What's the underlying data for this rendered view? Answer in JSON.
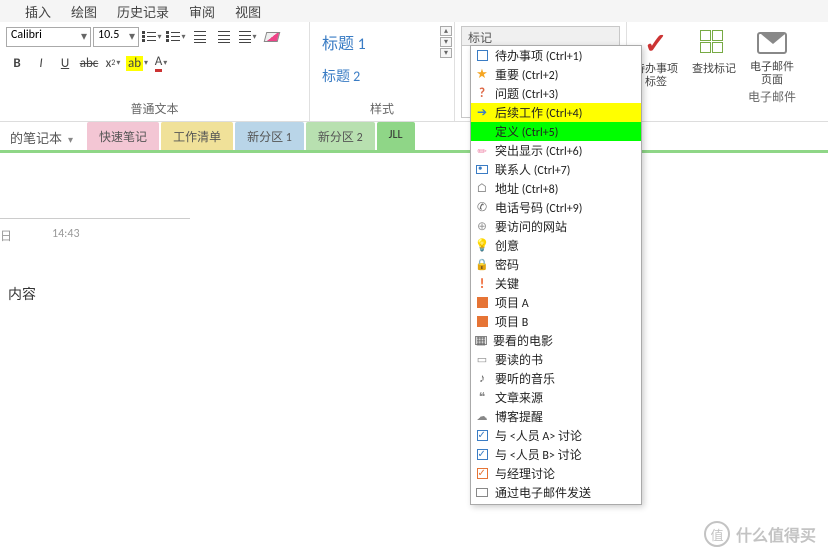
{
  "menu": [
    "插入",
    "绘图",
    "历史记录",
    "审阅",
    "视图"
  ],
  "font": {
    "name": "Calibri",
    "size": "10.5"
  },
  "styles": {
    "h1": "标题 1",
    "h2": "标题 2"
  },
  "groups": {
    "basic_text": "普通文本",
    "styles": "样式",
    "email": "电子邮件"
  },
  "tags_header": "标记",
  "big_buttons": {
    "todo": {
      "l1": "待办事项",
      "l2": "标签"
    },
    "find": "查找标记",
    "email": {
      "l1": "电子邮件",
      "l2": "页面"
    }
  },
  "notebook_name": "的笔记本",
  "sections": [
    {
      "label": "快速笔记",
      "cls": "tab-pink"
    },
    {
      "label": "工作清单",
      "cls": "tab-yellow"
    },
    {
      "label": "新分区 1",
      "cls": "tab-blue"
    },
    {
      "label": "新分区 2",
      "cls": "tab-green"
    },
    {
      "label": "JLL",
      "cls": "tab-green2"
    }
  ],
  "page": {
    "date_suffix": "日",
    "time": "14:43",
    "content": "内容"
  },
  "tags": [
    {
      "label": "待办事项 (Ctrl+1)",
      "icon": "checkbox"
    },
    {
      "label": "重要 (Ctrl+2)",
      "icon": "star"
    },
    {
      "label": "问题 (Ctrl+3)",
      "icon": "question"
    },
    {
      "label": "后续工作 (Ctrl+4)",
      "icon": "arrow",
      "hl": "yellow"
    },
    {
      "label": "定义 (Ctrl+5)",
      "icon": "none",
      "hl": "green"
    },
    {
      "label": "突出显示 (Ctrl+6)",
      "icon": "pen"
    },
    {
      "label": "联系人 (Ctrl+7)",
      "icon": "contact"
    },
    {
      "label": "地址 (Ctrl+8)",
      "icon": "home"
    },
    {
      "label": "电话号码 (Ctrl+9)",
      "icon": "phone"
    },
    {
      "label": "要访问的网站",
      "icon": "globe"
    },
    {
      "label": "创意",
      "icon": "bulb"
    },
    {
      "label": "密码",
      "icon": "lock"
    },
    {
      "label": "关键",
      "icon": "exclaim"
    },
    {
      "label": "项目 A",
      "icon": "square-a"
    },
    {
      "label": "项目 B",
      "icon": "square-b"
    },
    {
      "label": "要看的电影",
      "icon": "film"
    },
    {
      "label": "要读的书",
      "icon": "book"
    },
    {
      "label": "要听的音乐",
      "icon": "music"
    },
    {
      "label": "文章来源",
      "icon": "quote"
    },
    {
      "label": "博客提醒",
      "icon": "bell"
    },
    {
      "label": "与 <人员 A> 讨论",
      "icon": "cb-a"
    },
    {
      "label": "与 <人员 B> 讨论",
      "icon": "cb-a"
    },
    {
      "label": "与经理讨论",
      "icon": "cb-o"
    },
    {
      "label": "通过电子邮件发送",
      "icon": "mail"
    }
  ],
  "watermark": "什么值得买",
  "watermark_badge": "值"
}
